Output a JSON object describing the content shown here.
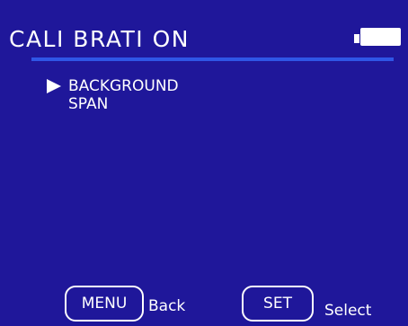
{
  "screen": {
    "title": "CALI BRATI ON",
    "background_color": "#1f179a",
    "divider_color": "#2f56e6",
    "battery": {
      "icon": "battery-icon",
      "level": 1.0
    }
  },
  "menu": {
    "selected_index": 0,
    "items": [
      {
        "label": "BACKGROUND",
        "selected": true
      },
      {
        "label": "SPAN",
        "selected": false
      }
    ]
  },
  "footer": {
    "menu_key_label": "MENU",
    "menu_key_action": "Back",
    "set_key_label": "SET",
    "set_key_action": "Select"
  }
}
